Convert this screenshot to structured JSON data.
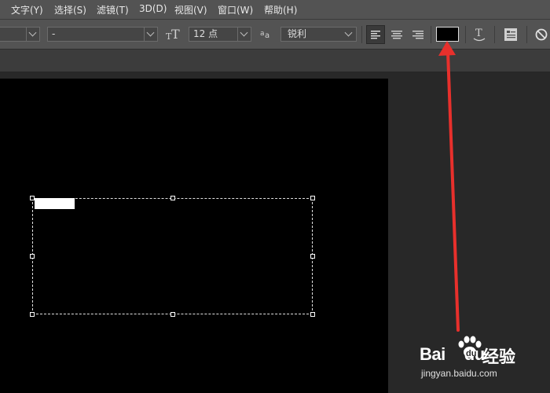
{
  "menubar": {
    "items": [
      {
        "label": "文字(Y)"
      },
      {
        "label": "选择(S)"
      },
      {
        "label": "滤镜(T)"
      },
      {
        "label": "3D(D)"
      },
      {
        "label": "视图(V)"
      },
      {
        "label": "窗口(W)"
      },
      {
        "label": "帮助(H)"
      }
    ]
  },
  "options": {
    "font_family_value": "",
    "font_style_value": "-",
    "font_size_value": "12 点",
    "antialias_value": "锐利",
    "text_color": "#000000",
    "align_selected": "left"
  },
  "colors": {
    "accent_arrow": "#e8302c",
    "canvas": "#000000",
    "workspace": "#282828",
    "panel": "#535353"
  },
  "watermark": {
    "brand": "Bai",
    "brand_suffix": "du",
    "cn_text": "经验",
    "url": "jingyan.baidu.com"
  }
}
